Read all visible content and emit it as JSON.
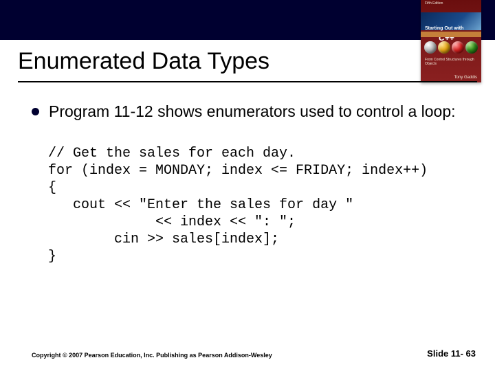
{
  "header": {
    "title": "Enumerated Data Types"
  },
  "book": {
    "edition": "Fifth Edition",
    "main_title": "Starting Out with",
    "cpp": "C++",
    "subtitle": "From Control Structures through Objects",
    "author": "Tony Gaddis"
  },
  "bullet_text": "Program 11-12 shows enumerators used to control a loop:",
  "code": "// Get the sales for each day.\nfor (index = MONDAY; index <= FRIDAY; index++)\n{\n   cout << \"Enter the sales for day \"\n             << index << \": \";\n        cin >> sales[index];\n}",
  "footer": {
    "copyright": "Copyright © 2007 Pearson Education, Inc. Publishing as Pearson Addison-Wesley",
    "slide_label": "Slide 11- 63"
  }
}
